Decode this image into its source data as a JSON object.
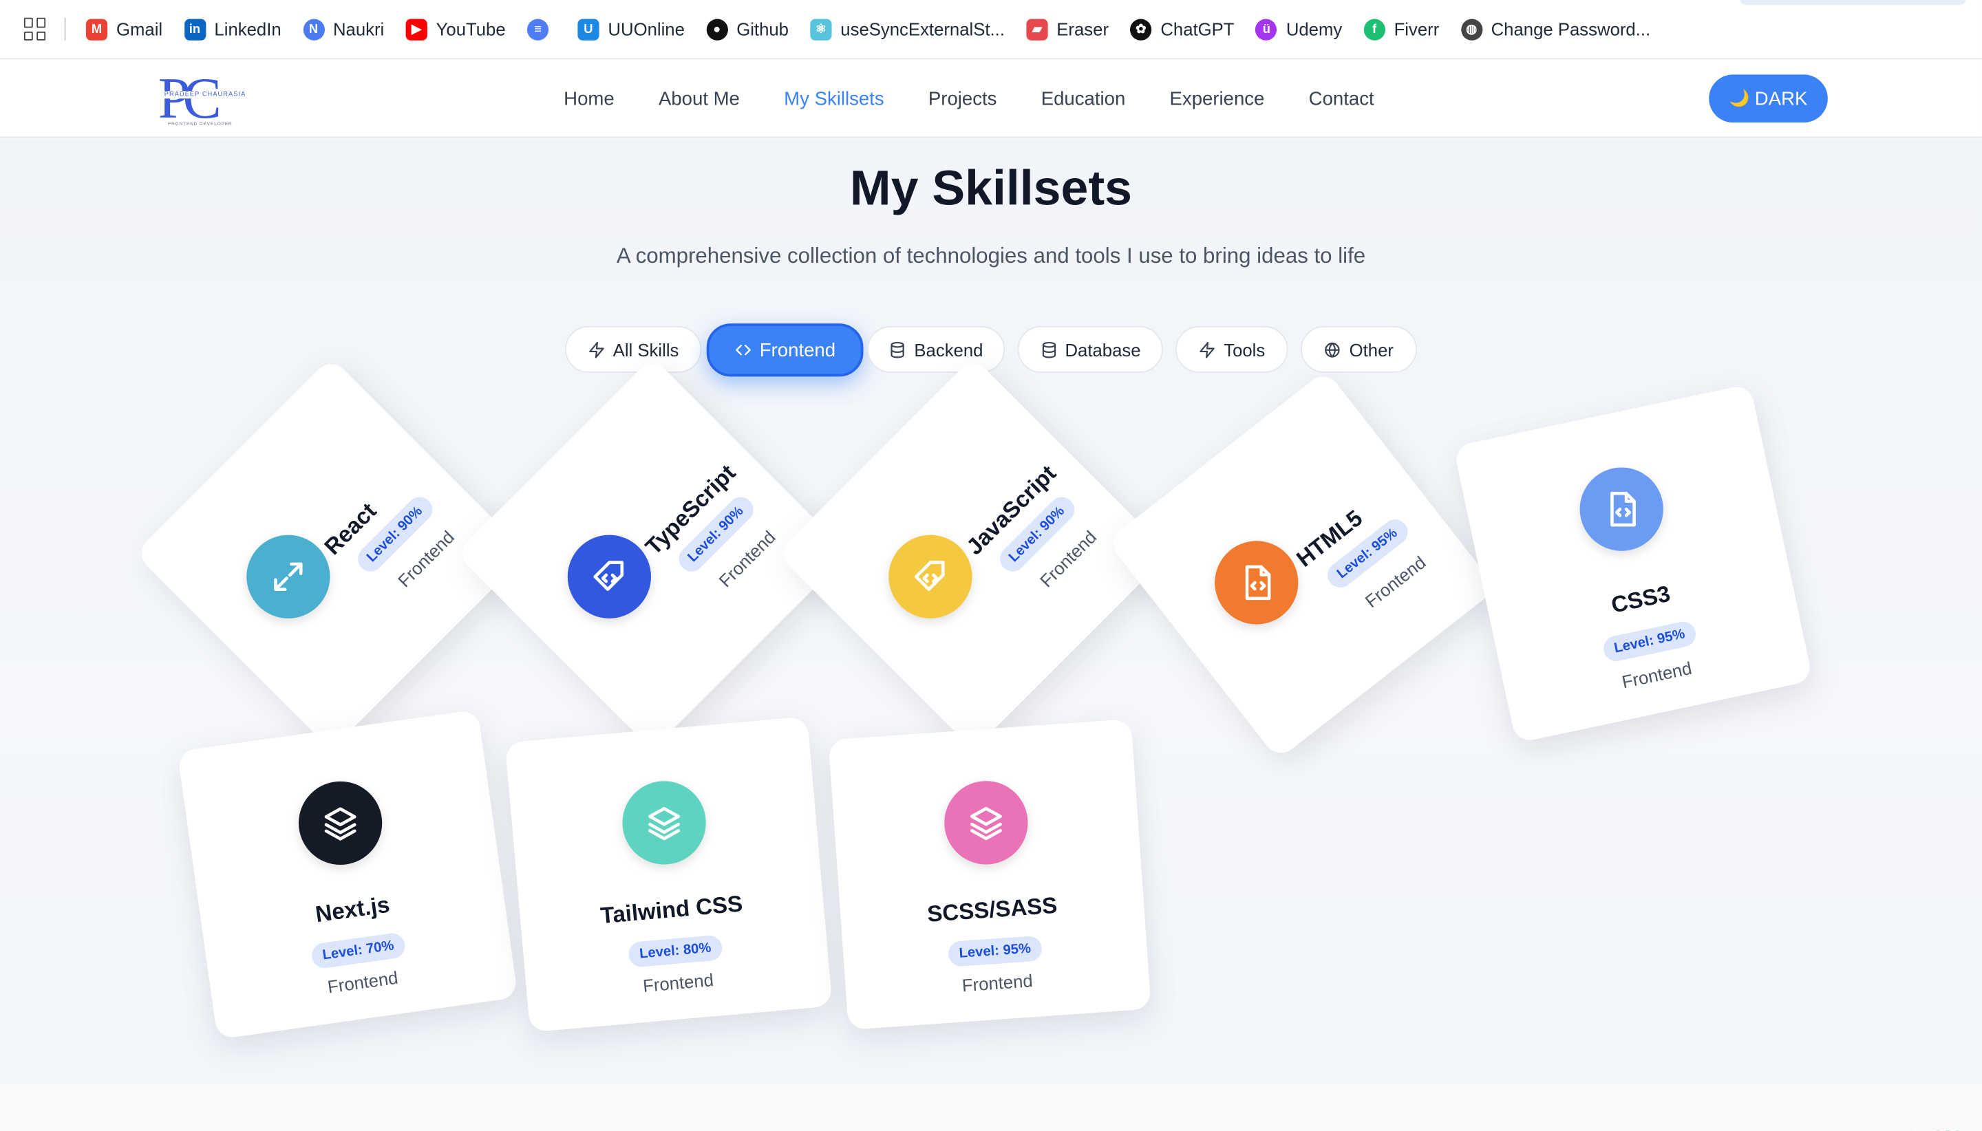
{
  "bookmarks": [
    {
      "label": "Gmail",
      "icon": "gmail-icon",
      "color": "#ea4335"
    },
    {
      "label": "LinkedIn",
      "icon": "linkedin-icon",
      "color": "#0a66c2"
    },
    {
      "label": "Naukri",
      "icon": "naukri-icon",
      "color": "#4a7cf0"
    },
    {
      "label": "YouTube",
      "icon": "youtube-icon",
      "color": "#ff0000"
    },
    {
      "label": "",
      "icon": "google-docs-icon",
      "color": "#4f7ef4"
    },
    {
      "label": "UUOnline",
      "icon": "uuonline-icon",
      "color": "#1e88e5"
    },
    {
      "label": "Github",
      "icon": "github-icon",
      "color": "#111111"
    },
    {
      "label": "useSyncExternalSt...",
      "icon": "react-icon",
      "color": "#58c4dc"
    },
    {
      "label": "Eraser",
      "icon": "eraser-icon",
      "color": "#e5484d"
    },
    {
      "label": "ChatGPT",
      "icon": "chatgpt-icon",
      "color": "#111111"
    },
    {
      "label": "Udemy",
      "icon": "udemy-icon",
      "color": "#a435f0"
    },
    {
      "label": "Fiverr",
      "icon": "fiverr-icon",
      "color": "#1dbf73"
    },
    {
      "label": "Change Password...",
      "icon": "globe-icon",
      "color": "#444444"
    }
  ],
  "logo": {
    "letters": "PC",
    "name": "PRADEEP CHAURASIA",
    "subtitle": "FRONTEND DEVELOPER"
  },
  "nav": {
    "items": [
      "Home",
      "About Me",
      "My Skillsets",
      "Projects",
      "Education",
      "Experience",
      "Contact"
    ],
    "active": "My Skillsets"
  },
  "theme_button": {
    "icon": "🌙",
    "label": "DARK"
  },
  "section": {
    "title": "My Skillsets",
    "subtitle": "A comprehensive collection of technologies and tools I use to bring ideas to life"
  },
  "filters": [
    {
      "label": "All Skills",
      "icon": "bolt-icon"
    },
    {
      "label": "Frontend",
      "icon": "code-icon",
      "active": true
    },
    {
      "label": "Backend",
      "icon": "database-icon"
    },
    {
      "label": "Database",
      "icon": "database-icon"
    },
    {
      "label": "Tools",
      "icon": "bolt-icon"
    },
    {
      "label": "Other",
      "icon": "globe-icon"
    }
  ],
  "skills": [
    {
      "name": "React",
      "level": "Level: 90%",
      "category": "Frontend",
      "color": "#4bb0cf",
      "icon": "expand-icon"
    },
    {
      "name": "TypeScript",
      "level": "Level: 90%",
      "category": "Frontend",
      "color": "#3358e0",
      "icon": "tag-code-icon"
    },
    {
      "name": "JavaScript",
      "level": "Level: 90%",
      "category": "Frontend",
      "color": "#f4c83f",
      "icon": "tag-code-icon"
    },
    {
      "name": "HTML5",
      "level": "Level: 95%",
      "category": "Frontend",
      "color": "#f07a2d",
      "icon": "file-code-icon"
    },
    {
      "name": "CSS3",
      "level": "Level: 95%",
      "category": "Frontend",
      "color": "#6b9cf2",
      "icon": "file-code-icon"
    },
    {
      "name": "Next.js",
      "level": "Level: 70%",
      "category": "Frontend",
      "color": "#141a26",
      "icon": "layers-icon"
    },
    {
      "name": "Tailwind CSS",
      "level": "Level: 80%",
      "category": "Frontend",
      "color": "#5ed3bf",
      "icon": "layers-icon"
    },
    {
      "name": "SCSS/SASS",
      "level": "Level: 95%",
      "category": "Frontend",
      "color": "#ea72b7",
      "icon": "layers-icon"
    }
  ],
  "assistant_button": {
    "icon": "openai-icon"
  }
}
